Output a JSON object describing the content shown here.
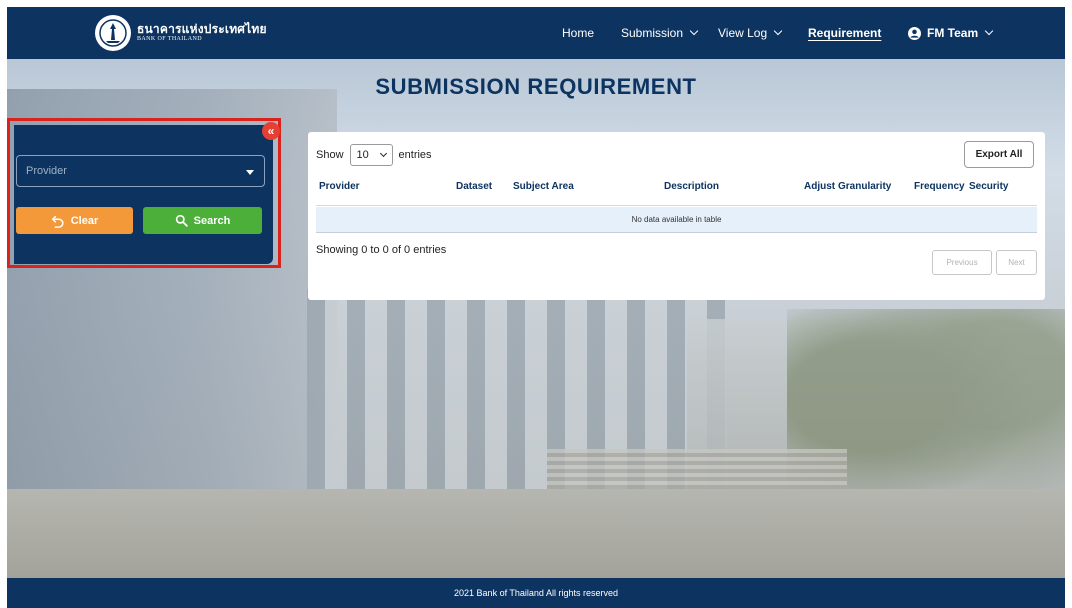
{
  "brand": {
    "name_th": "ธนาคารแห่งประเทศไทย",
    "name_en": "BANK OF THAILAND",
    "logo_icon": "bank-emblem-icon"
  },
  "nav": {
    "home": "Home",
    "submission": "Submission",
    "view_log": "View Log",
    "requirement": "Requirement",
    "team": "FM Team",
    "active": "Requirement"
  },
  "page": {
    "title": "SUBMISSION REQUIREMENT"
  },
  "filter": {
    "provider_placeholder": "Provider",
    "clear_label": "Clear",
    "search_label": "Search",
    "collapse_icon": "double-chevron-left-icon"
  },
  "table": {
    "show_label": "Show",
    "entries_value": "10",
    "entries_label": "entries",
    "export_label": "Export All",
    "columns": [
      "Provider",
      "Dataset",
      "Subject Area",
      "Description",
      "Adjust",
      "Granularity",
      "Frequency",
      "Security"
    ],
    "empty_message": "No data available in table",
    "info": "Showing 0 to 0 of 0 entries",
    "previous_label": "Previous",
    "next_label": "Next"
  },
  "footer": {
    "text": "2021 Bank of Thailand All rights reserved"
  },
  "colors": {
    "navy": "#0d3461",
    "clear_orange": "#f3993a",
    "search_green": "#4caf3a",
    "highlight_red": "#d9231f",
    "collapse_red": "#e63f34"
  }
}
